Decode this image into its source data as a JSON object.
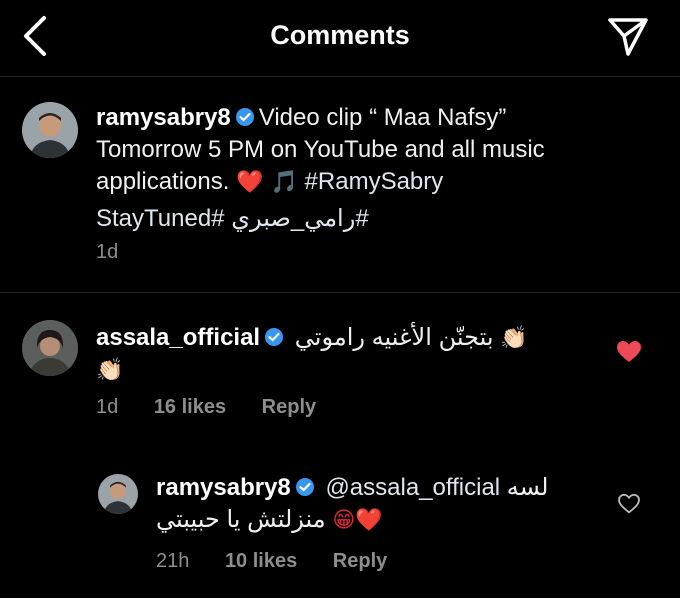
{
  "header": {
    "title": "Comments",
    "back_icon": "chevron-left-icon",
    "send_icon": "paper-plane-icon"
  },
  "caption": {
    "username": "ramysabry8",
    "line1": "Video clip “ Maa Nafsy”",
    "line2": "Tomorrow 5 PM on YouTube and all music",
    "line3_text": "applications.",
    "line3_emoji": "❤️ 🎵",
    "line3_tag": "#RamySabry",
    "line4": "StayTuned# رامي_صبري#",
    "time": "1d"
  },
  "comments": [
    {
      "username": "assala_official",
      "text": "بتجنّن الأغنيه راموتي",
      "emoji_inline": "👏🏻",
      "emoji_line2": "👏🏻",
      "time": "1d",
      "likes": "16 likes",
      "reply": "Reply",
      "liked": true
    }
  ],
  "reply": {
    "username": "ramysabry8",
    "mention": "@assala_official",
    "text_after": "لسه",
    "line2": "منزلتش يا حبيبتي",
    "line2_emoji": "😁❤️",
    "time": "21h",
    "likes": "10 likes",
    "reply": "Reply",
    "liked": false
  },
  "colors": {
    "background": "#000000",
    "text": "#f2f2f2",
    "meta": "#8e8e8e",
    "verified": "#3897f0",
    "liked_heart": "#ed4956"
  }
}
